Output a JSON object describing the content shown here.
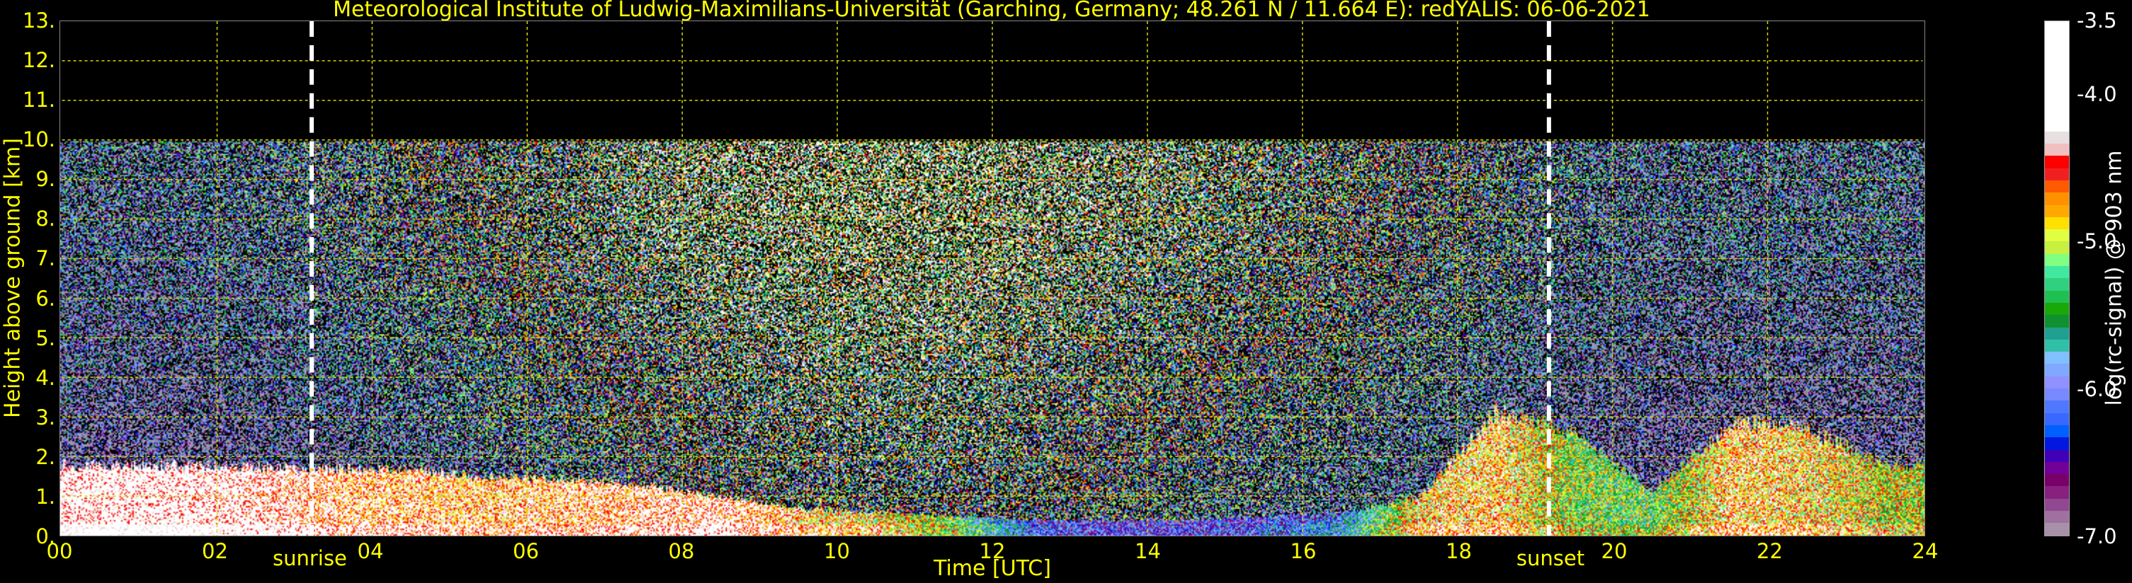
{
  "chart_data": {
    "type": "heatmap",
    "title": "Meteorological Institute of Ludwig-Maximilians-Universität (Garching, Germany; 48.261 N / 11.664 E):    redYALIS: 06-06-2021",
    "xlabel": "Time [UTC]",
    "ylabel": "Height above ground [km]",
    "xlim": [
      0,
      24
    ],
    "ylim": [
      0,
      13
    ],
    "x_ticks": [
      "00",
      "02",
      "04",
      "06",
      "08",
      "10",
      "12",
      "14",
      "16",
      "18",
      "20",
      "22",
      "24"
    ],
    "y_ticks": [
      "0.",
      "1.",
      "2.",
      "3.",
      "4.",
      "5.",
      "6.",
      "7.",
      "8.",
      "9.",
      "10.",
      "11.",
      "12.",
      "13."
    ],
    "grid": true,
    "data_top_km": 10,
    "hours": [
      0,
      1,
      2,
      3,
      4,
      5,
      6,
      7,
      8,
      9,
      10,
      11,
      12,
      13,
      14,
      15,
      16,
      17,
      18,
      19,
      20,
      21,
      22,
      23
    ],
    "boundary_layer_top_km": [
      1.8,
      1.8,
      1.75,
      1.7,
      1.7,
      1.5,
      1.45,
      1.3,
      1.0,
      0.7,
      0.6,
      0.5,
      0.4,
      0.4,
      0.4,
      0.5,
      0.6,
      1.0,
      3.2,
      2.6,
      1.1,
      2.9,
      2.7,
      1.8
    ],
    "boundary_layer_log_signal": [
      -4.0,
      -4.0,
      -4.1,
      -4.3,
      -4.4,
      -4.5,
      -4.4,
      -4.3,
      -4.2,
      -4.6,
      -4.8,
      -5.3,
      -6.3,
      -6.5,
      -6.5,
      -6.3,
      -6.0,
      -4.7,
      -4.6,
      -5.2,
      -5.3,
      -4.6,
      -4.7,
      -5.0
    ],
    "upper_background_log_signal": [
      -5.9,
      -5.9,
      -5.8,
      -5.6,
      -5.4,
      -5.2,
      -5.0,
      -4.8,
      -4.6,
      -4.5,
      -4.45,
      -4.45,
      -4.55,
      -4.7,
      -4.8,
      -5.0,
      -5.1,
      -5.3,
      -5.5,
      -5.8,
      -5.9,
      -5.9,
      -5.9,
      -5.9
    ],
    "annotations": [
      {
        "text": "sunrise",
        "hour": 3.22
      },
      {
        "text": "sunset",
        "hour": 19.18
      }
    ],
    "colorbar": {
      "label": "log(rc-signal) @ 903 nm",
      "range": [
        -7.0,
        -3.5
      ],
      "ticks": [
        "-3.5",
        "-4.0",
        "-5.0",
        "-6.0",
        "-7.0"
      ],
      "tick_values": [
        -3.5,
        -4.0,
        -5.0,
        -6.0,
        -7.0
      ],
      "colors_high_to_low": [
        "#ffffff",
        "#e8e0e0",
        "#f0c0c0",
        "#ff0000",
        "#f02020",
        "#ff5a00",
        "#ff9000",
        "#ffa800",
        "#ffe000",
        "#e0ff40",
        "#c8f040",
        "#80ff80",
        "#40e8a0",
        "#30d080",
        "#20c050",
        "#18a808",
        "#109030",
        "#20a090",
        "#30c0a8",
        "#80c0ff",
        "#80a8ff",
        "#9090ff",
        "#7888ff",
        "#5078ff",
        "#3868ff",
        "#0060ff",
        "#0018e0",
        "#4000b8",
        "#700098",
        "#780068",
        "#882080",
        "#904890",
        "#a070a0",
        "#a890a8"
      ]
    }
  }
}
